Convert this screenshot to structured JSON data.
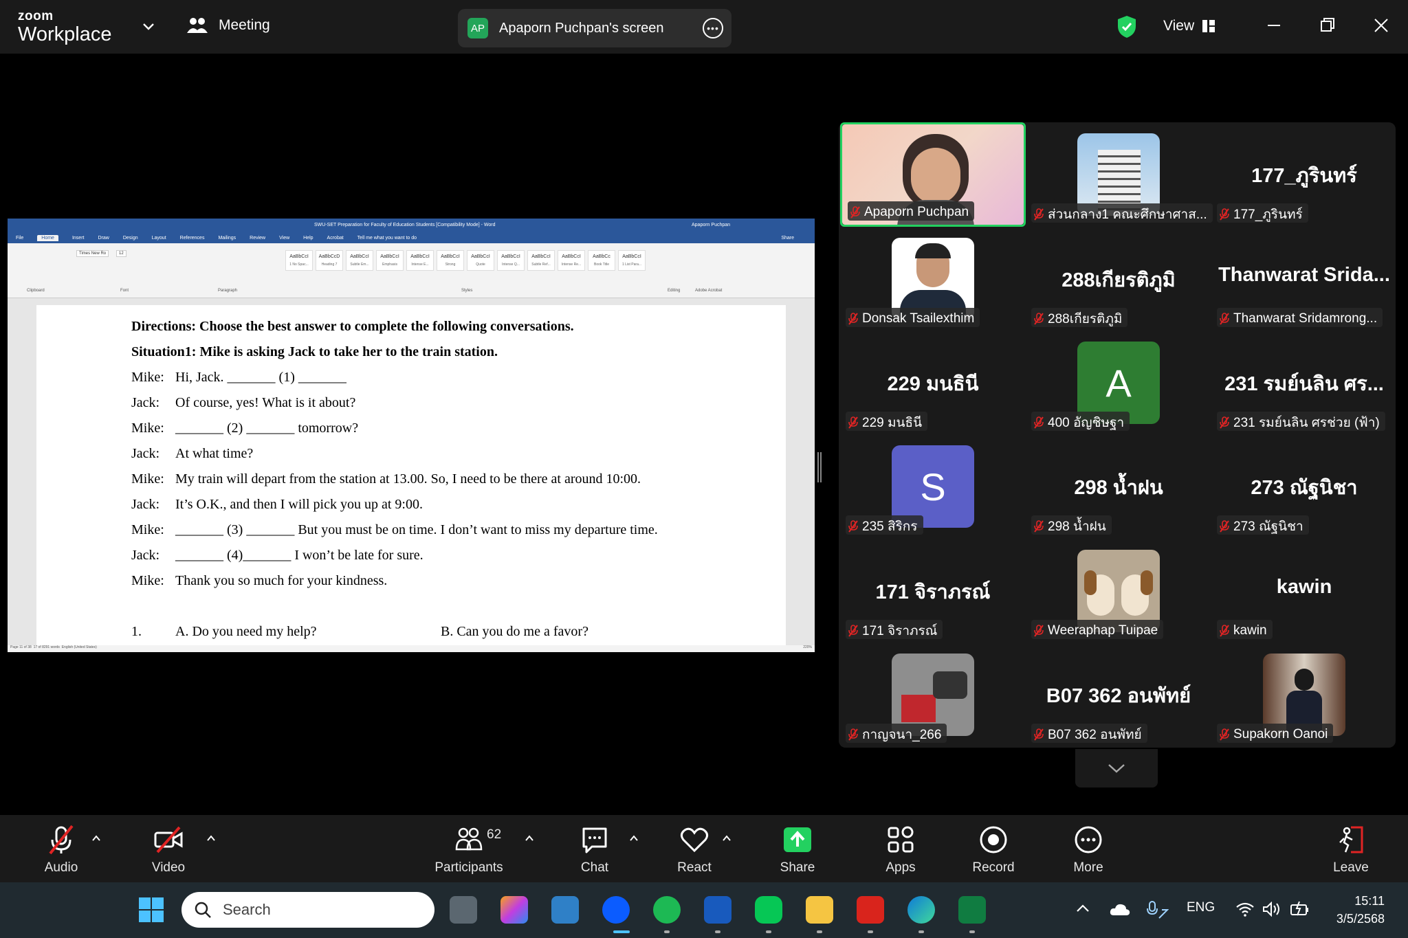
{
  "app": {
    "brand_top": "zoom",
    "brand_bottom": "Workplace",
    "meeting_label": "Meeting"
  },
  "screen_share": {
    "initials": "AP",
    "label": "Apaporn Puchpan's screen"
  },
  "view_label": "View",
  "word": {
    "title": "SWU-SET Preparation for Faculty of Education Students [Compatibility Mode] - Word",
    "user": "Apaporn Puchpan",
    "tabs": [
      "File",
      "Home",
      "Insert",
      "Draw",
      "Design",
      "Layout",
      "References",
      "Mailings",
      "Review",
      "View",
      "Help",
      "Acrobat",
      "Tell me what you want to do"
    ],
    "share": "Share",
    "styles": [
      {
        "sample": "AaBbCcI",
        "name": "1 No Spac..."
      },
      {
        "sample": "AaBbCcD",
        "name": "Heading 7"
      },
      {
        "sample": "AaBbCcI",
        "name": "Subtle Em..."
      },
      {
        "sample": "AaBbCcI",
        "name": "Emphasis"
      },
      {
        "sample": "AaBbCcI",
        "name": "Intense E..."
      },
      {
        "sample": "AaBbCcI",
        "name": "Strong"
      },
      {
        "sample": "AaBbCcI",
        "name": "Quote"
      },
      {
        "sample": "AaBbCcI",
        "name": "Intense Q..."
      },
      {
        "sample": "AaBbCcI",
        "name": "Subtle Ref..."
      },
      {
        "sample": "AaBbCcI",
        "name": "Intense Re..."
      },
      {
        "sample": "AaBbCc",
        "name": "Book Title"
      },
      {
        "sample": "AaBbCcI",
        "name": "1 List Para..."
      }
    ],
    "groups": [
      "Clipboard",
      "Font",
      "Paragraph",
      "Styles",
      "Editing",
      "Adobe Acrobat"
    ],
    "font_name": "Times New Ro",
    "font_size": "12",
    "status": {
      "page": "Page 11 of 38",
      "words": "17 of 8291 words",
      "lang": "English (United States)",
      "zoom": "220%"
    },
    "doc": {
      "directions": "Directions: Choose the best answer to complete the following conversations.",
      "situation": "Situation1: Mike is asking Jack to take her to the train station.",
      "lines": [
        {
          "speaker": "Mike:",
          "text": "Hi, Jack. _______ (1) _______"
        },
        {
          "speaker": "Jack:",
          "text": "Of course, yes! What is it about?"
        },
        {
          "speaker": "Mike:",
          "text": "_______ (2) _______ tomorrow?"
        },
        {
          "speaker": "Jack:",
          "text": "At what time?"
        },
        {
          "speaker": "Mike:",
          "text": "My train will depart from the station at 13.00. So, I need to be there at around 10:00."
        },
        {
          "speaker": "Jack:",
          "text": "It’s O.K., and then I will pick you up at 9:00."
        },
        {
          "speaker": "Mike:",
          "text": "_______ (3) _______ But you must be on time. I don’t want to miss my departure time."
        },
        {
          "speaker": "Jack:",
          "text": "_______ (4)_______ I won’t be late for sure."
        },
        {
          "speaker": "Mike:",
          "text": "Thank you so much for your kindness."
        }
      ],
      "q_num": "1.",
      "q_a": "A. Do you need my help?",
      "q_b": "B. Can you do me a favor?"
    }
  },
  "participants_grid": [
    {
      "big": "",
      "name": "Apaporn Puchpan",
      "type": "video"
    },
    {
      "big": "",
      "name": "ส่วนกลาง1 คณะศึกษาศาส...",
      "type": "building"
    },
    {
      "big": "177_ภูรินทร์",
      "name": "177_ภูรินทร์",
      "type": "text"
    },
    {
      "big": "",
      "name": "Donsak Tsailexthim",
      "type": "portrait"
    },
    {
      "big": "288เกียรติภูมิ",
      "name": "288เกียรติภูมิ",
      "type": "text"
    },
    {
      "big": "Thanwarat Srida...",
      "name": "Thanwarat Sridamrong...",
      "type": "text"
    },
    {
      "big": "229 มนธินี",
      "name": "229 มนธินี",
      "type": "text"
    },
    {
      "big": "A",
      "name": "400 อัญชิษฐา",
      "type": "avatar",
      "color": "#2e7d32"
    },
    {
      "big": "231 รมย์นลิน ศร...",
      "name": "231 รมย์นลิน ศรช่วย (ฟ้า)",
      "type": "text"
    },
    {
      "big": "S",
      "name": "235 สิริกร",
      "type": "avatar",
      "color": "#5b5fc7"
    },
    {
      "big": "298 น้ำฝน",
      "name": "298 น้ำฝน",
      "type": "text"
    },
    {
      "big": "273 ณัฐนิชา",
      "name": "273 ณัฐนิชา",
      "type": "text"
    },
    {
      "big": "171 จิราภรณ์",
      "name": "171 จิราภรณ์",
      "type": "text"
    },
    {
      "big": "",
      "name": "Weeraphap Tuipae",
      "type": "dogs"
    },
    {
      "big": "kawin",
      "name": "kawin",
      "type": "text"
    },
    {
      "big": "",
      "name": "กาญจนา_266",
      "type": "objects"
    },
    {
      "big": "B07 362 อนพัทย์",
      "name": "B07 362 อนพัทย์",
      "type": "text"
    },
    {
      "big": "",
      "name": "Supakorn Oanoi",
      "type": "person"
    }
  ],
  "toolbar": {
    "audio": "Audio",
    "video": "Video",
    "participants": "Participants",
    "participant_count": "62",
    "chat": "Chat",
    "react": "React",
    "share": "Share",
    "apps": "Apps",
    "record": "Record",
    "more": "More",
    "leave": "Leave"
  },
  "taskbar": {
    "search": "Search",
    "lang": "ENG",
    "time": "15:11",
    "date": "3/5/2568"
  },
  "colors": {
    "accent_green": "#23d160",
    "zoom_blue": "#0b5cff",
    "word_blue": "#2b579a"
  }
}
